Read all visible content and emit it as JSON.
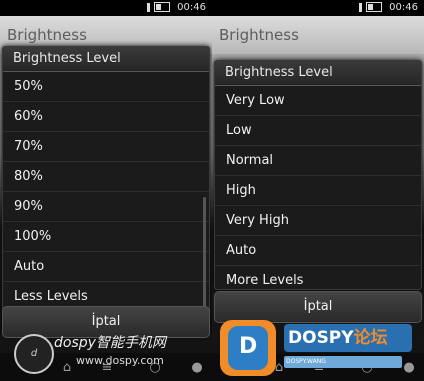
{
  "status": {
    "time": "00:46"
  },
  "left": {
    "title": "Brightness",
    "dialog_title": "Brightness Level",
    "items": [
      "50%",
      "60%",
      "70%",
      "80%",
      "90%",
      "100%",
      "Auto",
      "Less Levels"
    ],
    "ok_label": "İptal"
  },
  "right": {
    "title": "Brightness",
    "dialog_title": "Brightness Level",
    "items": [
      "Very Low",
      "Low",
      "Normal",
      "High",
      "Very High",
      "Auto",
      "More Levels"
    ],
    "ok_label": "İptal"
  },
  "watermark_left": {
    "name": "dospy智能手机网",
    "url": "www.dospy.com"
  },
  "watermark_right": {
    "badge": "D",
    "brand": "DOSPY",
    "brand_cn": "论坛",
    "slogan": "DOSPY.WANG"
  },
  "colors": {
    "accent": "#2d7ec4",
    "dialog": "#1b1b1b",
    "titlebar": "#c8c8c8"
  }
}
